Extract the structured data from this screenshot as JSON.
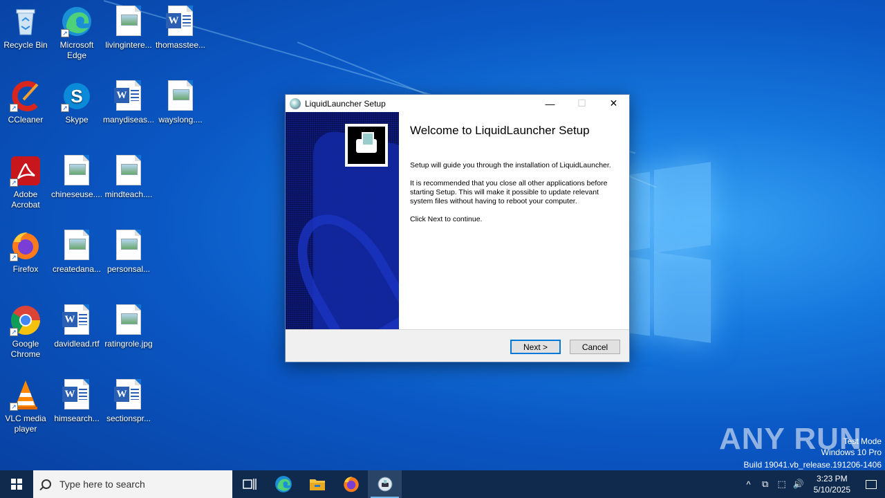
{
  "desktop": {
    "icons": [
      {
        "label": "Recycle Bin",
        "icon": "recycle-bin-icon"
      },
      {
        "label": "Microsoft Edge",
        "icon": "edge-icon"
      },
      {
        "label": "livingintere...",
        "icon": "image-file-icon"
      },
      {
        "label": "thomasstee...",
        "icon": "word-file-icon"
      },
      {
        "label": "CCleaner",
        "icon": "ccleaner-icon"
      },
      {
        "label": "Skype",
        "icon": "skype-icon"
      },
      {
        "label": "manydiseas...",
        "icon": "word-file-icon"
      },
      {
        "label": "wayslong....",
        "icon": "image-file-icon"
      },
      {
        "label": "Adobe Acrobat",
        "icon": "acrobat-icon"
      },
      {
        "label": "chineseuse....",
        "icon": "image-file-icon"
      },
      {
        "label": "mindteach....",
        "icon": "image-file-icon"
      },
      {
        "label": "Firefox",
        "icon": "firefox-icon"
      },
      {
        "label": "createdana...",
        "icon": "image-file-icon"
      },
      {
        "label": "personsal...",
        "icon": "image-file-icon"
      },
      {
        "label": "Google Chrome",
        "icon": "chrome-icon"
      },
      {
        "label": "davidlead.rtf",
        "icon": "word-file-icon"
      },
      {
        "label": "ratingrole.jpg",
        "icon": "image-file-icon"
      },
      {
        "label": "VLC media player",
        "icon": "vlc-icon"
      },
      {
        "label": "himsearch...",
        "icon": "word-file-icon"
      },
      {
        "label": "sectionspr...",
        "icon": "word-file-icon"
      }
    ]
  },
  "dialog": {
    "title": "LiquidLauncher Setup",
    "heading": "Welcome to LiquidLauncher Setup",
    "para1": "Setup will guide you through the installation of LiquidLauncher.",
    "para2": "It is recommended that you close all other applications before starting Setup. This will make it possible to update relevant system files without having to reboot your computer.",
    "para3": "Click Next to continue.",
    "next_label": "Next >",
    "cancel_label": "Cancel",
    "minimize_glyph": "—",
    "maximize_glyph": "☐",
    "close_glyph": "✕"
  },
  "watermark": {
    "brand": "ANY RUN",
    "line1": "Test Mode",
    "line2": "Windows 10 Pro",
    "line3": "Build 19041.vb_release.191206-1406"
  },
  "taskbar": {
    "search_placeholder": "Type here to search",
    "time": "3:23 PM",
    "date": "5/10/2025",
    "apps": [
      "task-view-icon",
      "edge-icon",
      "file-explorer-icon",
      "firefox-icon",
      "liquidlauncher-setup-icon"
    ],
    "tray_up": "^",
    "tray_glyphs": [
      "⧉",
      "⬚",
      "🔊"
    ]
  },
  "colors": {
    "accent": "#0078d7",
    "taskbar": "#102a4e",
    "banner": "#0d1c86"
  }
}
